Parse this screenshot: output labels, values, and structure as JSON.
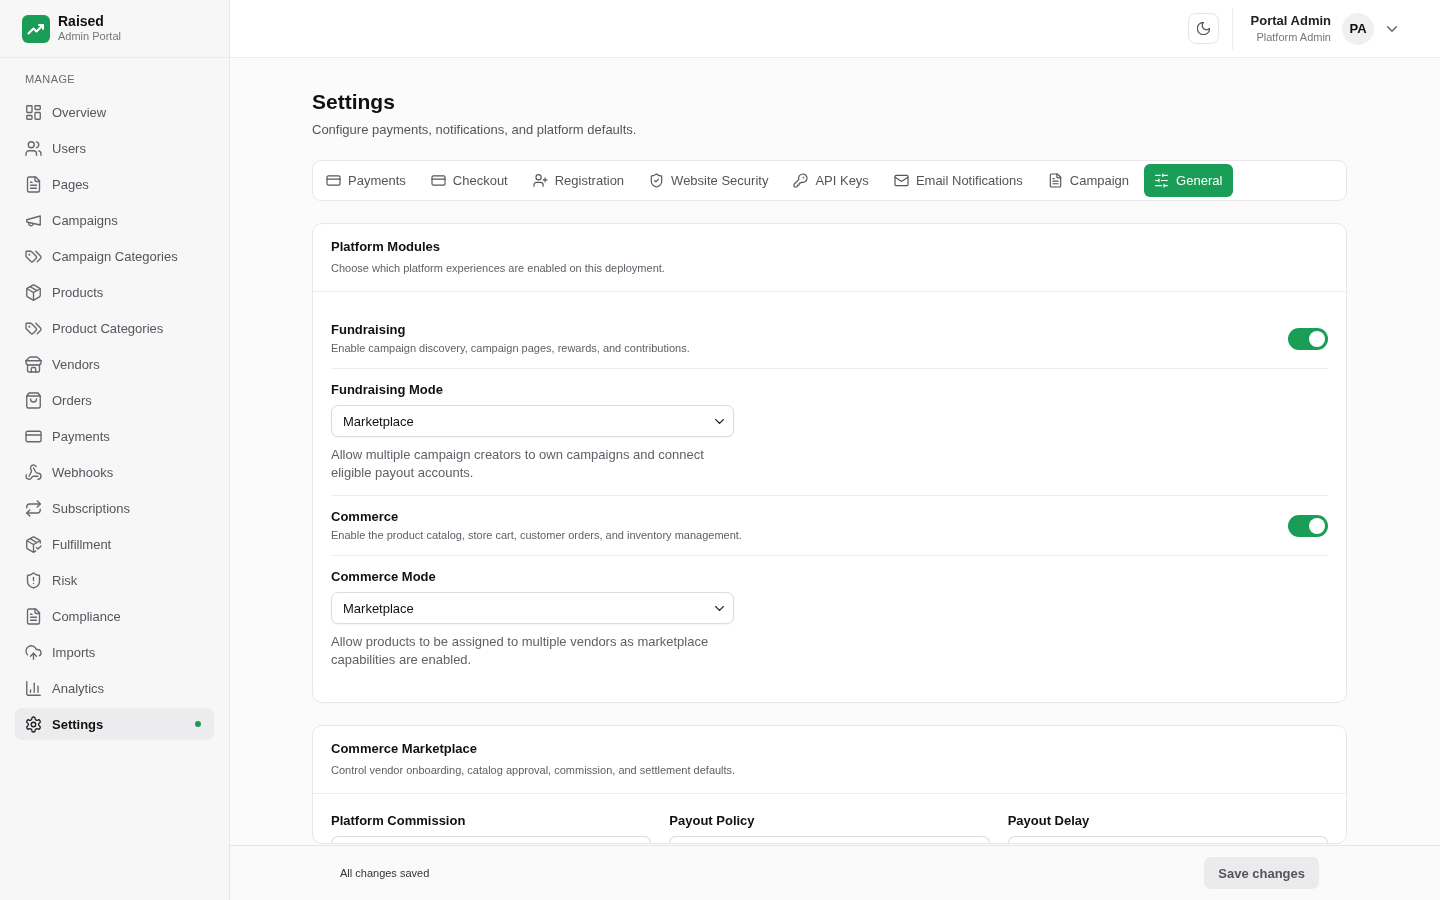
{
  "sidebar": {
    "brand": {
      "name": "Raised",
      "subtitle": "Admin Portal"
    },
    "section_label": "MANAGE",
    "items": [
      {
        "label": "Overview",
        "selected": false
      },
      {
        "label": "Users",
        "selected": false
      },
      {
        "label": "Pages",
        "selected": false
      },
      {
        "label": "Campaigns",
        "selected": false
      },
      {
        "label": "Campaign Categories",
        "selected": false
      },
      {
        "label": "Products",
        "selected": false
      },
      {
        "label": "Product Categories",
        "selected": false
      },
      {
        "label": "Vendors",
        "selected": false
      },
      {
        "label": "Orders",
        "selected": false
      },
      {
        "label": "Payments",
        "selected": false
      },
      {
        "label": "Webhooks",
        "selected": false
      },
      {
        "label": "Subscriptions",
        "selected": false
      },
      {
        "label": "Fulfillment",
        "selected": false
      },
      {
        "label": "Risk",
        "selected": false
      },
      {
        "label": "Compliance",
        "selected": false
      },
      {
        "label": "Imports",
        "selected": false
      },
      {
        "label": "Analytics",
        "selected": false
      },
      {
        "label": "Settings",
        "selected": true
      }
    ]
  },
  "header": {
    "user": {
      "name": "Portal Admin",
      "role": "Platform Admin",
      "initials": "PA"
    }
  },
  "page": {
    "title": "Settings",
    "subtitle": "Configure payments, notifications, and platform defaults."
  },
  "tabs": [
    {
      "label": "Payments",
      "selected": false
    },
    {
      "label": "Checkout",
      "selected": false
    },
    {
      "label": "Registration",
      "selected": false
    },
    {
      "label": "Website Security",
      "selected": false
    },
    {
      "label": "API Keys",
      "selected": false
    },
    {
      "label": "Email Notifications",
      "selected": false
    },
    {
      "label": "Campaign",
      "selected": false
    },
    {
      "label": "General",
      "selected": true
    }
  ],
  "sections": [
    {
      "title": "Platform Modules",
      "description": "Choose which platform experiences are enabled on this deployment.",
      "rows": [
        {
          "kind": "toggle",
          "label": "Fundraising",
          "description": "Enable campaign discovery, campaign pages, rewards, and contributions.",
          "on": true
        },
        {
          "kind": "select",
          "label": "Fundraising Mode",
          "value": "Marketplace",
          "hint": "Allow multiple campaign creators to own campaigns and connect eligible payout accounts."
        },
        {
          "kind": "toggle",
          "label": "Commerce",
          "description": "Enable the product catalog, store cart, customer orders, and inventory management.",
          "on": true
        },
        {
          "kind": "select",
          "label": "Commerce Mode",
          "value": "Marketplace",
          "hint": "Allow products to be assigned to multiple vendors as marketplace capabilities are enabled."
        }
      ]
    },
    {
      "title": "Commerce Marketplace",
      "description": "Control vendor onboarding, catalog approval, commission, and settlement defaults.",
      "fields": [
        {
          "label": "Platform Commission"
        },
        {
          "label": "Payout Policy"
        },
        {
          "label": "Payout Delay"
        }
      ]
    }
  ],
  "footer": {
    "status": "All changes saved",
    "save_button": {
      "label": "Save changes",
      "disabled": true
    }
  }
}
